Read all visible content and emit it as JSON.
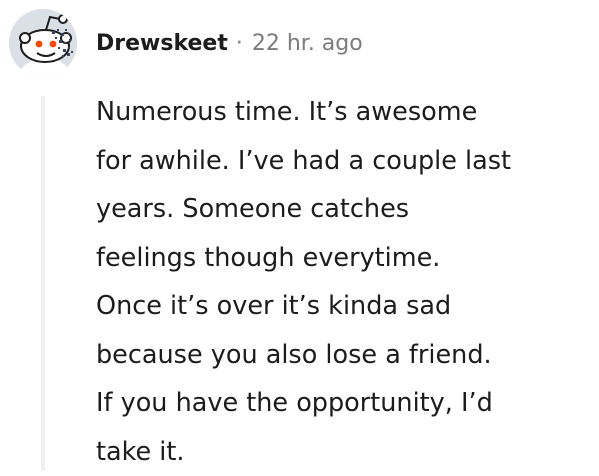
{
  "comment": {
    "avatar_icon": "reddit-snoo-avatar-icon",
    "author": "Drewskeet",
    "separator": "·",
    "timestamp": "22 hr. ago",
    "body_lines": [
      "Numerous time. It’s awesome",
      "for awhile. I’ve had a couple last",
      "years. Someone catches",
      "feelings though everytime.",
      "Once it’s over it’s kinda sad",
      "because you also lose a friend.",
      "If you have the opportunity, I’d",
      "take it."
    ]
  },
  "colors": {
    "avatar_background": "#dae0e6",
    "thread_line": "#edeff1",
    "meta_text": "#7c7c7c",
    "body_text": "#1c1c1c",
    "snoo_eye": "#ff4500"
  }
}
